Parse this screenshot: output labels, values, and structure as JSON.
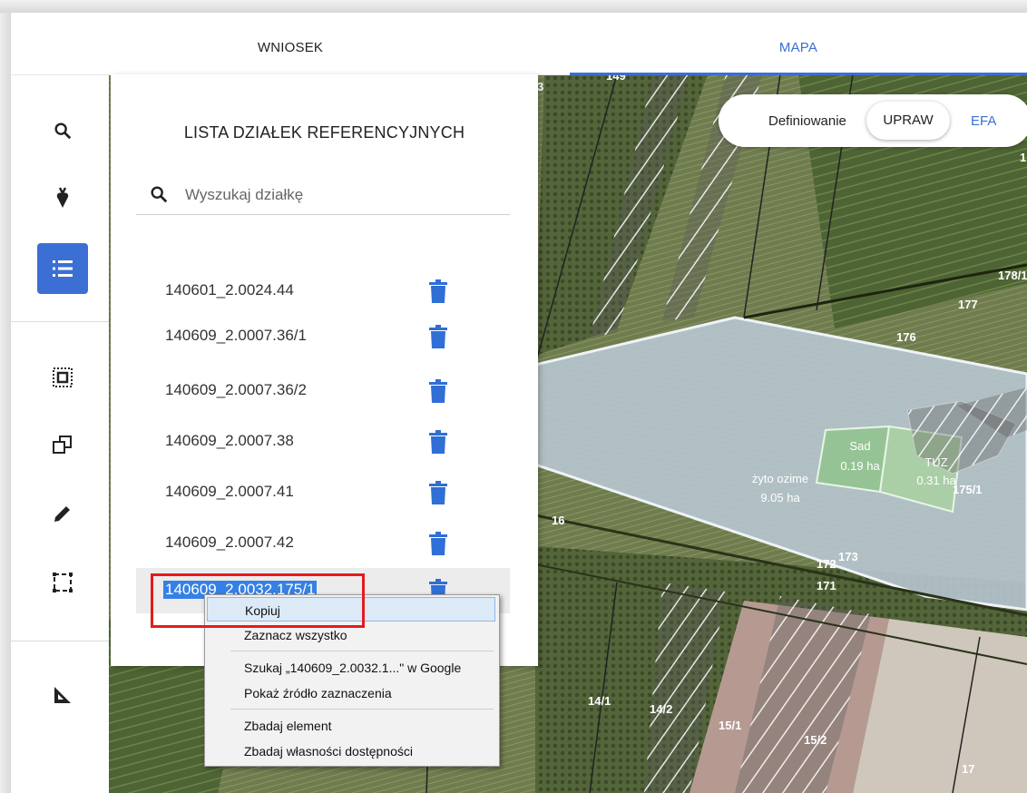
{
  "tabs": [
    {
      "label": "WNIOSEK",
      "active": false
    },
    {
      "label": "MAPA",
      "active": true
    }
  ],
  "toolbar": {
    "tools": [
      "search-icon",
      "crop-icon",
      "list-icon",
      "select-area-icon",
      "copy-shapes-icon",
      "edit-pencil-icon",
      "draw-rectangle-icon",
      "measure-icon"
    ],
    "active": "list-icon"
  },
  "panel": {
    "title": "LISTA DZIAŁEK REFERENCYJNYCH",
    "search_placeholder": "Wyszukaj działkę",
    "rows": [
      "140601_2.0024.44",
      "140609_2.0007.36/1",
      "140609_2.0007.36/2",
      "140609_2.0007.38",
      "140609_2.0007.41",
      "140609_2.0007.42",
      "140609_2.0032.175/1"
    ],
    "selected_row": "140609_2.0032.175/1"
  },
  "map_mode": {
    "label": "Definiowanie",
    "options": [
      "UPRAW",
      "EFA"
    ],
    "selected": "UPRAW"
  },
  "context_menu": {
    "items": [
      {
        "label": "Kopiuj",
        "hover": true
      },
      {
        "label": "Zaznacz wszystko"
      },
      {
        "label": "Szukaj „140609_2.0032.1...\" w Google"
      },
      {
        "label": "Pokaż źródło zaznaczenia"
      },
      {
        "label": "Zbadaj element"
      },
      {
        "label": "Zbadaj własności dostępności"
      }
    ]
  },
  "map": {
    "parcel_labels": [
      "149",
      "178/1",
      "177",
      "176",
      "175/1",
      "16",
      "172",
      "173",
      "171",
      "14/1",
      "14/2",
      "15/1",
      "15/2",
      "17",
      "1",
      "3"
    ],
    "crops": [
      {
        "name": "żyto ozime",
        "area": "9.05 ha"
      },
      {
        "name": "Sad",
        "area": "0.19 ha"
      },
      {
        "name": "TUZ",
        "area": "0.31 ha"
      }
    ]
  },
  "colors": {
    "accent": "#3b6fd4",
    "highlight_box": "#e41b1b",
    "selection": "#3580e6"
  }
}
